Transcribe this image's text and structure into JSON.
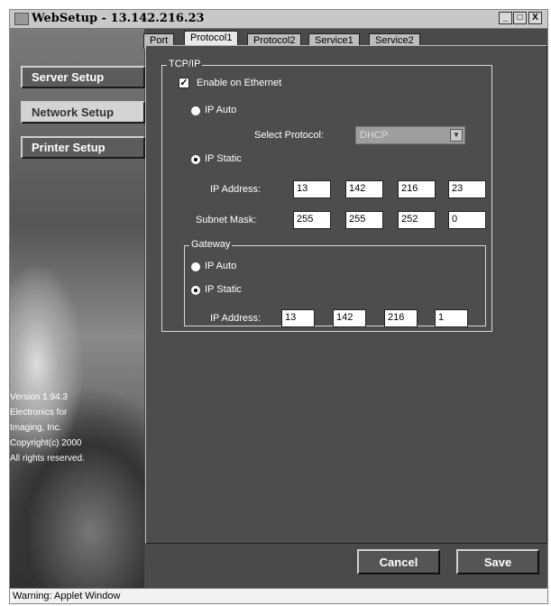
{
  "window": {
    "title": "WebSetup - 13.142.216.23",
    "minimize": "_",
    "maximize": "□",
    "close": "X"
  },
  "tabs": [
    "Port",
    "Protocol1",
    "Protocol2",
    "Service1",
    "Service2"
  ],
  "active_tab": "Protocol1",
  "sidebar": {
    "items": [
      {
        "label": "Server Setup"
      },
      {
        "label": "Network Setup",
        "active": true
      },
      {
        "label": "Printer Setup"
      }
    ],
    "version_lines": [
      "Version 1.94.3",
      "Electronics for",
      "Imaging, Inc.",
      "Copyright(c) 2000",
      "All rights reserved."
    ]
  },
  "tcpip": {
    "group_label": "TCP/IP",
    "enable_ethernet": {
      "label": "Enable on Ethernet",
      "checked": true
    },
    "ip_auto": {
      "label": "IP Auto",
      "selected": false
    },
    "select_protocol": {
      "label": "Select Protocol:",
      "value": "DHCP"
    },
    "ip_static": {
      "label": "IP Static",
      "selected": true
    },
    "ip_address": {
      "label": "IP Address:",
      "octets": [
        "13",
        "142",
        "216",
        "23"
      ]
    },
    "subnet_mask": {
      "label": "Subnet Mask:",
      "octets": [
        "255",
        "255",
        "252",
        "0"
      ]
    },
    "gateway": {
      "group_label": "Gateway",
      "ip_auto": {
        "label": "IP Auto",
        "selected": false
      },
      "ip_static": {
        "label": "IP Static",
        "selected": true
      },
      "ip_address": {
        "label": "IP Address:",
        "octets": [
          "13",
          "142",
          "216",
          "1"
        ]
      }
    }
  },
  "buttons": {
    "cancel": "Cancel",
    "save": "Save"
  },
  "status": "Warning: Applet Window"
}
